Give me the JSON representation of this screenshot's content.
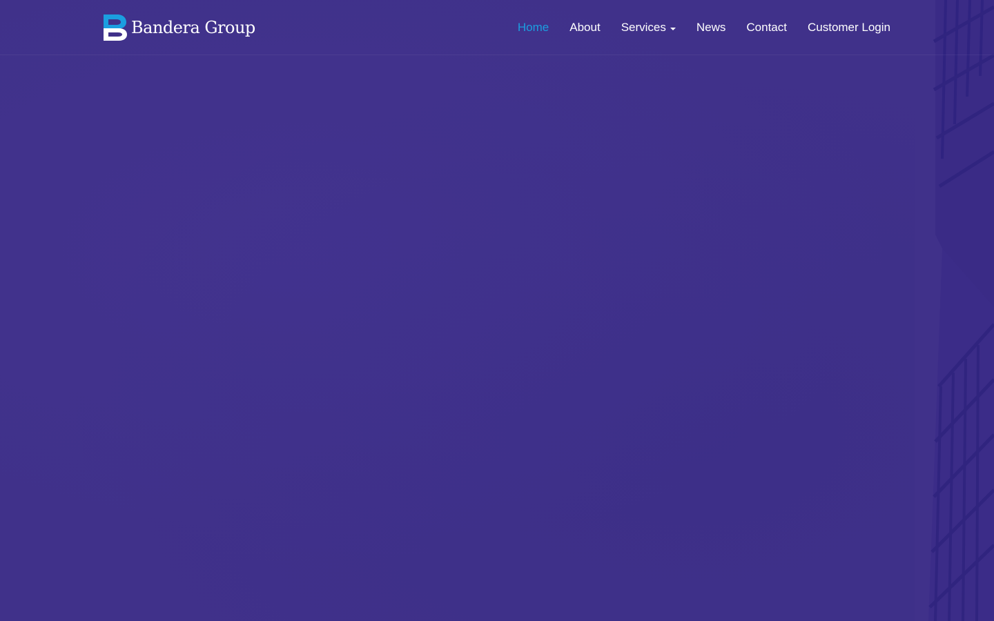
{
  "brand": {
    "name": "Bandera Group",
    "mark_color_dark": "#1b9ee0",
    "mark_color_light": "#ffffff"
  },
  "nav": {
    "items": [
      {
        "label": "Home",
        "active": true
      },
      {
        "label": "About"
      },
      {
        "label": "Services",
        "has_dropdown": true,
        "icon": "caret-down-icon"
      },
      {
        "label": "News"
      },
      {
        "label": "Contact"
      },
      {
        "label": "Customer Login"
      }
    ],
    "active_color": "#1b9ee0",
    "text_color": "#ffffff"
  },
  "hero": {
    "background_color": "#40318a",
    "decor": "building-facade"
  }
}
